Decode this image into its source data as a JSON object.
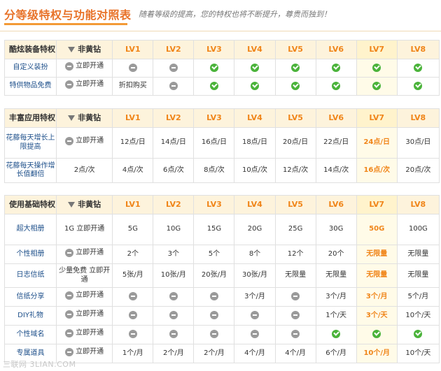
{
  "header": {
    "title": "分等级特权与功能对照表",
    "subtitle": "随着等级的提高，您的特权也将不断提升，尊贵而独到！"
  },
  "levels": [
    "LV1",
    "LV2",
    "LV3",
    "LV4",
    "LV5",
    "LV6",
    "LV7",
    "LV8"
  ],
  "non_vip_label": "非黄钻",
  "sections": [
    {
      "title": "酷炫装备特权",
      "rows": [
        {
          "label": "自定义装扮",
          "nonvip": "open",
          "cells": [
            "no",
            "no",
            "ok",
            "ok",
            "ok",
            "ok",
            "ok",
            "ok"
          ]
        },
        {
          "label": "特供物品免费",
          "nonvip": "open",
          "cells": [
            "折扣购买",
            "no",
            "ok",
            "ok",
            "ok",
            "ok",
            "ok",
            "ok"
          ]
        }
      ]
    },
    {
      "title": "丰富应用特权",
      "rows": [
        {
          "label": "花藤每天增长上限提高",
          "nonvip": "open",
          "cells": [
            "12点/日",
            "14点/日",
            "16点/日",
            "18点/日",
            "20点/日",
            "22点/日",
            "24点/日",
            "30点/日"
          ]
        },
        {
          "label": "花藤每天操作增长值翻倍",
          "nonvip": "2点/次",
          "cells": [
            "4点/次",
            "6点/次",
            "8点/次",
            "10点/次",
            "12点/次",
            "14点/次",
            "16点/次",
            "20点/次"
          ]
        }
      ]
    },
    {
      "title": "使用基础特权",
      "rows": [
        {
          "label": "超大相册",
          "nonvip": "1G 立即开通",
          "cells": [
            "5G",
            "10G",
            "15G",
            "20G",
            "25G",
            "30G",
            "50G",
            "100G"
          ]
        },
        {
          "label": "个性相册",
          "nonvip": "open",
          "cells": [
            "2个",
            "3个",
            "5个",
            "8个",
            "12个",
            "20个",
            "无限量",
            "无限量"
          ]
        },
        {
          "label": "日志信纸",
          "nonvip": "少量免费 立即开通",
          "cells": [
            "5张/月",
            "10张/月",
            "20张/月",
            "30张/月",
            "无限量",
            "无限量",
            "无限量",
            "无限量"
          ]
        },
        {
          "label": "信纸分享",
          "nonvip": "open",
          "cells": [
            "no",
            "no",
            "no",
            "3个/月",
            "no",
            "3个/月",
            "3个/月",
            "5个/月"
          ]
        },
        {
          "label": "DIY礼物",
          "nonvip": "open",
          "cells": [
            "no",
            "no",
            "no",
            "no",
            "no",
            "1个/天",
            "3个/天",
            "10个/天"
          ]
        },
        {
          "label": "个性域名",
          "nonvip": "open",
          "cells": [
            "no",
            "no",
            "no",
            "no",
            "no",
            "ok",
            "ok",
            "ok"
          ]
        },
        {
          "label": "专属道具",
          "nonvip": "open",
          "cells": [
            "1个/月",
            "2个/月",
            "2个/月",
            "4个/月",
            "4个/月",
            "6个/月",
            "10个/月",
            "10个/天"
          ]
        }
      ]
    }
  ],
  "open_label": "立即开通",
  "watermark": "三联网 3LIAN.COM"
}
